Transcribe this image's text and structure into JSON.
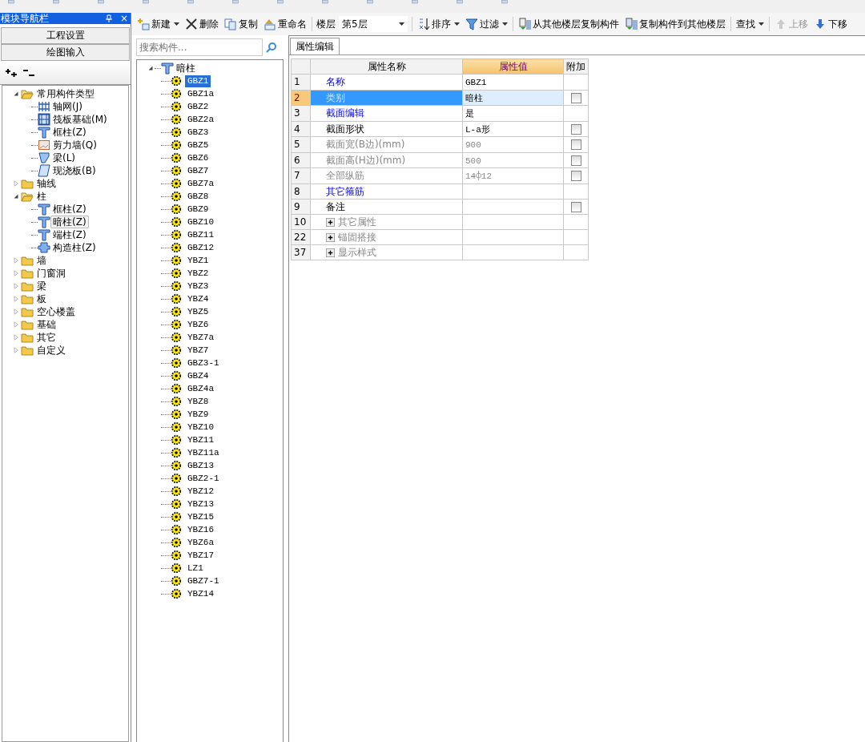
{
  "nav_panel": {
    "title": "模块导航栏",
    "close": "×",
    "buttons": [
      "工程设置",
      "绘图输入"
    ],
    "tree": [
      {
        "label": "常用构件类型",
        "expanded": true,
        "selected": false,
        "children": [
          {
            "label": "轴网(J)",
            "kind": "grid",
            "selected": false
          },
          {
            "label": "筏板基础(M)",
            "kind": "raft",
            "selected": false
          },
          {
            "label": "框柱(Z)",
            "kind": "column",
            "selected": false
          },
          {
            "label": "剪力墙(Q)",
            "kind": "wall",
            "selected": false
          },
          {
            "label": "梁(L)",
            "kind": "beam",
            "selected": false
          },
          {
            "label": "现浇板(B)",
            "kind": "slab",
            "selected": false
          }
        ]
      },
      {
        "label": "轴线",
        "expanded": false,
        "selected": false
      },
      {
        "label": "柱",
        "expanded": true,
        "selected": false,
        "children": [
          {
            "label": "框柱(Z)",
            "kind": "column",
            "selected": false
          },
          {
            "label": "暗柱(Z)",
            "kind": "column",
            "selected": true
          },
          {
            "label": "端柱(Z)",
            "kind": "column",
            "selected": false
          },
          {
            "label": "构造柱(Z)",
            "kind": "puzzle",
            "selected": false
          }
        ]
      },
      {
        "label": "墙",
        "expanded": false,
        "selected": false
      },
      {
        "label": "门窗洞",
        "expanded": false,
        "selected": false
      },
      {
        "label": "梁",
        "expanded": false,
        "selected": false
      },
      {
        "label": "板",
        "expanded": false,
        "selected": false
      },
      {
        "label": "空心楼盖",
        "expanded": false,
        "selected": false
      },
      {
        "label": "基础",
        "expanded": false,
        "selected": false
      },
      {
        "label": "其它",
        "expanded": false,
        "selected": false
      },
      {
        "label": "自定义",
        "expanded": false,
        "selected": false
      }
    ]
  },
  "toolbar": [
    {
      "kind": "button",
      "label": "新建",
      "dropdown": true,
      "disabled": false
    },
    {
      "kind": "button",
      "label": "删除",
      "dropdown": false,
      "disabled": false
    },
    {
      "kind": "button",
      "label": "复制",
      "dropdown": false,
      "disabled": false
    },
    {
      "kind": "button",
      "label": "重命名",
      "dropdown": false,
      "disabled": false
    },
    {
      "kind": "select",
      "label": "楼层",
      "value": "第5层"
    },
    {
      "kind": "button",
      "label": "排序",
      "dropdown": true,
      "disabled": false
    },
    {
      "kind": "button",
      "label": "过滤",
      "dropdown": true,
      "disabled": false
    },
    {
      "kind": "button",
      "label": "从其他楼层复制构件",
      "dropdown": false,
      "disabled": false
    },
    {
      "kind": "button",
      "label": "复制构件到其他楼层",
      "dropdown": false,
      "disabled": false
    },
    {
      "kind": "button",
      "label": "查找",
      "dropdown": true,
      "disabled": false
    },
    {
      "kind": "button",
      "label": "上移",
      "dropdown": false,
      "disabled": true
    },
    {
      "kind": "button",
      "label": "下移",
      "dropdown": false,
      "disabled": false
    }
  ],
  "component_list": {
    "placeholder": "搜索构件...",
    "root": "暗柱",
    "expanded": true,
    "items": [
      {
        "label": "GBZ1",
        "selected": true
      },
      {
        "label": "GBZ1a",
        "selected": false
      },
      {
        "label": "GBZ2",
        "selected": false
      },
      {
        "label": "GBZ2a",
        "selected": false
      },
      {
        "label": "GBZ3",
        "selected": false
      },
      {
        "label": "GBZ5",
        "selected": false
      },
      {
        "label": "GBZ6",
        "selected": false
      },
      {
        "label": "GBZ7",
        "selected": false
      },
      {
        "label": "GBZ7a",
        "selected": false
      },
      {
        "label": "GBZ8",
        "selected": false
      },
      {
        "label": "GBZ9",
        "selected": false
      },
      {
        "label": "GBZ10",
        "selected": false
      },
      {
        "label": "GBZ11",
        "selected": false
      },
      {
        "label": "GBZ12",
        "selected": false
      },
      {
        "label": "YBZ1",
        "selected": false
      },
      {
        "label": "YBZ2",
        "selected": false
      },
      {
        "label": "YBZ3",
        "selected": false
      },
      {
        "label": "YBZ4",
        "selected": false
      },
      {
        "label": "YBZ5",
        "selected": false
      },
      {
        "label": "YBZ6",
        "selected": false
      },
      {
        "label": "YBZ7a",
        "selected": false
      },
      {
        "label": "YBZ7",
        "selected": false
      },
      {
        "label": "GBZ3-1",
        "selected": false
      },
      {
        "label": "GBZ4",
        "selected": false
      },
      {
        "label": "GBZ4a",
        "selected": false
      },
      {
        "label": "YBZ8",
        "selected": false
      },
      {
        "label": "YBZ9",
        "selected": false
      },
      {
        "label": "YBZ10",
        "selected": false
      },
      {
        "label": "YBZ11",
        "selected": false
      },
      {
        "label": "YBZ11a",
        "selected": false
      },
      {
        "label": "GBZ13",
        "selected": false
      },
      {
        "label": "GBZ2-1",
        "selected": false
      },
      {
        "label": "YBZ12",
        "selected": false
      },
      {
        "label": "YBZ13",
        "selected": false
      },
      {
        "label": "YBZ15",
        "selected": false
      },
      {
        "label": "YBZ16",
        "selected": false
      },
      {
        "label": "YBZ6a",
        "selected": false
      },
      {
        "label": "YBZ17",
        "selected": false
      },
      {
        "label": "LZ1",
        "selected": false
      },
      {
        "label": "GBZ7-1",
        "selected": false
      },
      {
        "label": "YBZ14",
        "selected": false
      }
    ]
  },
  "property_editor": {
    "tab": "属性编辑",
    "columns": [
      "属性名称",
      "属性值",
      "附加"
    ],
    "rows": [
      {
        "num": "1",
        "name": "名称",
        "value": "GBZ1",
        "kind": "public",
        "checkbox": false,
        "selected": false
      },
      {
        "num": "2",
        "name": "类别",
        "value": "暗柱",
        "kind": "public",
        "checkbox": true,
        "checked": false,
        "selected": true
      },
      {
        "num": "3",
        "name": "截面编辑",
        "value": "是",
        "kind": "public",
        "checkbox": false,
        "selected": false
      },
      {
        "num": "4",
        "name": "截面形状",
        "value": "L-a形",
        "kind": "private",
        "checkbox": true,
        "checked": false,
        "selected": false
      },
      {
        "num": "5",
        "name": "截面宽(B边)(mm)",
        "value": "900",
        "kind": "disabled",
        "checkbox": true,
        "checked": false,
        "selected": false
      },
      {
        "num": "6",
        "name": "截面高(H边)(mm)",
        "value": "500",
        "kind": "disabled",
        "checkbox": true,
        "checked": false,
        "selected": false
      },
      {
        "num": "7",
        "name": "全部纵筋",
        "value": "14⌽12",
        "kind": "disabled",
        "checkbox": true,
        "checked": false,
        "selected": false
      },
      {
        "num": "8",
        "name": "其它箍筋",
        "kind": "public",
        "checkbox": false,
        "selected": false
      },
      {
        "num": "9",
        "name": "备注",
        "kind": "private",
        "checkbox": true,
        "checked": false,
        "selected": false
      },
      {
        "num": "10",
        "name": "其它属性",
        "kind": "group",
        "expanded": false,
        "selected": false
      },
      {
        "num": "22",
        "name": "锚固搭接",
        "kind": "group",
        "expanded": false,
        "selected": false
      },
      {
        "num": "37",
        "name": "显示样式",
        "kind": "group",
        "expanded": false,
        "selected": false
      }
    ]
  }
}
